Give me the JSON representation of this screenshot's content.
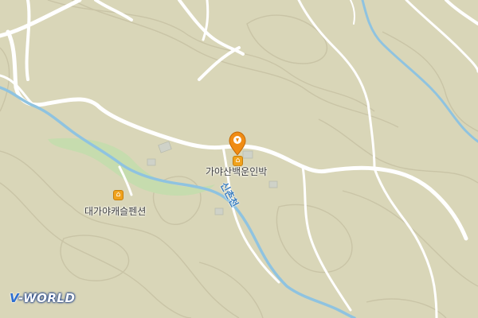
{
  "map": {
    "land_color": "#d9d6b8",
    "road_color": "#ffffff",
    "contour_color": "#c9c4a6",
    "water_color": "#8fc3e0",
    "park_color": "#c6dcae",
    "building_color": "#cfd2c8",
    "pois": [
      {
        "label": "가야산백운인박",
        "icon": "hotel-icon",
        "selected": true
      },
      {
        "label": "대가야캐슬펜션",
        "icon": "hotel-icon",
        "selected": false
      }
    ],
    "river_label": "신촌천",
    "marker_color": "#f08c14",
    "logo": {
      "prefix": "V",
      "text": "-WORLD"
    }
  }
}
